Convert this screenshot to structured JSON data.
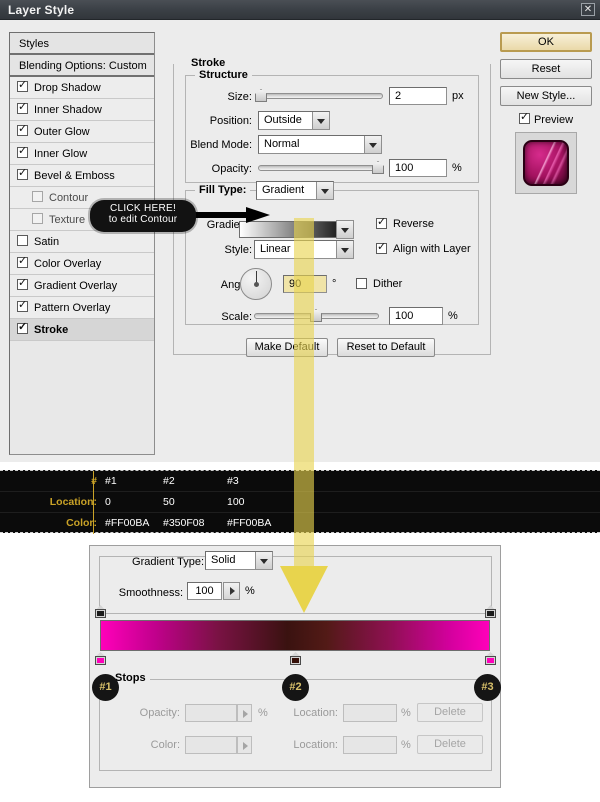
{
  "window": {
    "title": "Layer Style",
    "close_label": "✕"
  },
  "styles_panel": {
    "header": "Styles",
    "blending_options": "Blending Options: Custom",
    "items": [
      {
        "label": "Drop Shadow",
        "checked": true,
        "sub": false,
        "selected": false
      },
      {
        "label": "Inner Shadow",
        "checked": true,
        "sub": false,
        "selected": false
      },
      {
        "label": "Outer Glow",
        "checked": true,
        "sub": false,
        "selected": false
      },
      {
        "label": "Inner Glow",
        "checked": true,
        "sub": false,
        "selected": false
      },
      {
        "label": "Bevel & Emboss",
        "checked": true,
        "sub": false,
        "selected": false
      },
      {
        "label": "Contour",
        "checked": false,
        "sub": true,
        "selected": false
      },
      {
        "label": "Texture",
        "checked": false,
        "sub": true,
        "selected": false
      },
      {
        "label": "Satin",
        "checked": false,
        "sub": false,
        "selected": false
      },
      {
        "label": "Color Overlay",
        "checked": true,
        "sub": false,
        "selected": false
      },
      {
        "label": "Gradient Overlay",
        "checked": true,
        "sub": false,
        "selected": false
      },
      {
        "label": "Pattern Overlay",
        "checked": true,
        "sub": false,
        "selected": false
      },
      {
        "label": "Stroke",
        "checked": true,
        "sub": false,
        "selected": true
      }
    ]
  },
  "buttons": {
    "ok": "OK",
    "reset": "Reset",
    "new_style": "New Style...",
    "preview_label": "Preview",
    "preview_checked": true
  },
  "stroke": {
    "group_label": "Stroke",
    "structure_label": "Structure",
    "size_label": "Size:",
    "size_value": "2",
    "size_unit": "px",
    "position_label": "Position:",
    "position_value": "Outside",
    "blend_mode_label": "Blend Mode:",
    "blend_mode_value": "Normal",
    "opacity_label": "Opacity:",
    "opacity_value": "100",
    "opacity_unit": "%"
  },
  "fill": {
    "fill_type_label": "Fill Type:",
    "fill_type_value": "Gradient",
    "gradient_label": "Gradient:",
    "reverse_label": "Reverse",
    "reverse_checked": true,
    "style_label": "Style:",
    "style_value": "Linear",
    "align_label": "Align with Layer",
    "align_checked": true,
    "angle_label": "Angle:",
    "angle_value": "90",
    "angle_unit": "°",
    "dither_label": "Dither",
    "dither_checked": false,
    "scale_label": "Scale:",
    "scale_value": "100",
    "scale_unit": "%",
    "make_default": "Make Default",
    "reset_to_default": "Reset to Default"
  },
  "data_table": {
    "row_labels": [
      "#",
      "Location:",
      "Color:"
    ],
    "columns": [
      "#1",
      "#2",
      "#3"
    ],
    "location": [
      "0",
      "50",
      "100"
    ],
    "color": [
      "#FF00BA",
      "#350F08",
      "#FF00BA"
    ]
  },
  "gradient_editor": {
    "gradient_type_label": "Gradient Type:",
    "gradient_type_value": "Solid",
    "smoothness_label": "Smoothness:",
    "smoothness_value": "100",
    "smoothness_unit": "%",
    "stops_label": "Stops",
    "opacity_label": "Opacity:",
    "opacity_unit": "%",
    "opacity_location_label": "Location:",
    "opacity_location_unit": "%",
    "opacity_delete": "Delete",
    "color_label": "Color:",
    "color_location_label": "Location:",
    "color_location_unit": "%",
    "color_delete": "Delete",
    "stop_badges": [
      "#1",
      "#2",
      "#3"
    ],
    "stop_colors": [
      "#FF00BA",
      "#350F08",
      "#FF00BA"
    ],
    "stop_locations": [
      0,
      50,
      100
    ]
  },
  "annotation": {
    "callout_line1": "CLICK HERE!",
    "callout_line2": "to edit Contour"
  },
  "colors": {
    "accent_yellow": "#e8d44d",
    "table_label_gold": "#c9a227",
    "magenta": "#FF00BA",
    "dark_brown": "#350F08"
  }
}
